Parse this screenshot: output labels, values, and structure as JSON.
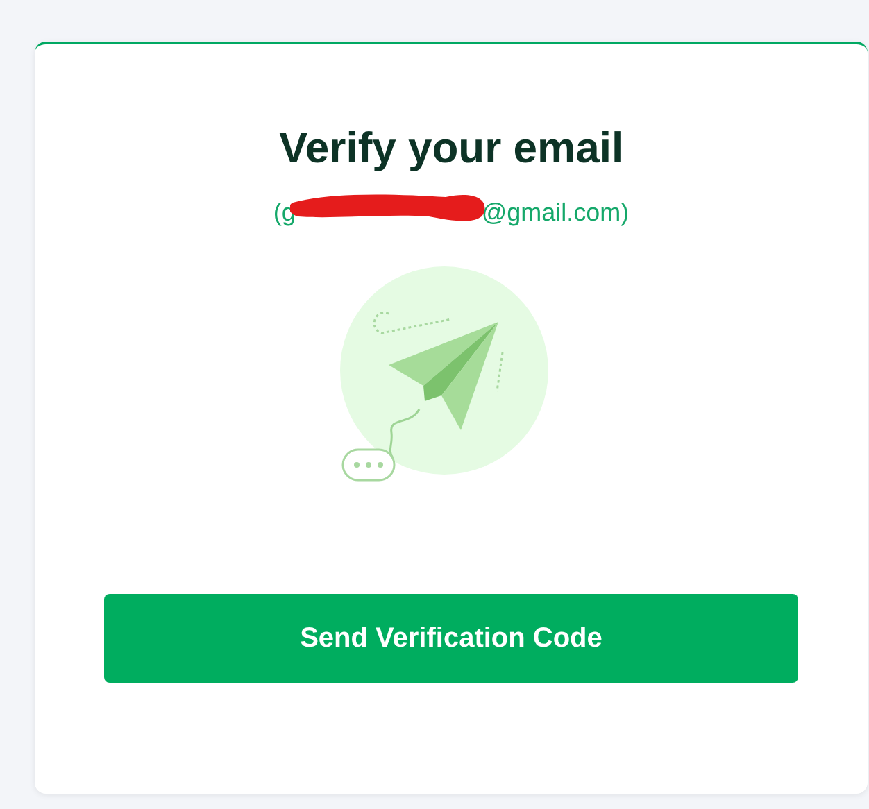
{
  "card": {
    "title": "Verify your email",
    "email": {
      "visible_start": "(g",
      "redacted": true,
      "visible_end": "@gmail.com)"
    },
    "illustration": {
      "kind": "paper-plane"
    },
    "button": {
      "label": "Send Verification Code"
    }
  }
}
